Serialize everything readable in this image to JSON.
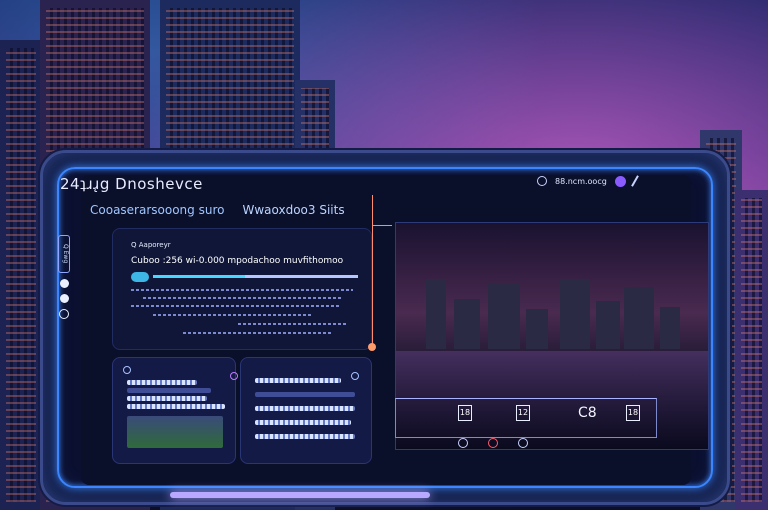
{
  "window": {
    "title": "24ʇɹɹ̨g Dnoshevce",
    "subtitle_left": "Cooaserarsooong suro",
    "subtitle_right": "Wwaoxdoo3 Siits"
  },
  "status_bar": {
    "icons": [
      "refresh-icon",
      "signal-icon",
      "avatar-dot",
      "edit-icon"
    ],
    "text": "88.ncm.oocg"
  },
  "info_panel": {
    "heading": "Q Aaporeyr",
    "line": "Cuboo :256 wi-0.000 mpodachoo muvfithomoo",
    "meter_level": 0.45
  },
  "left_controls": {
    "bar_label": "Q Ewg"
  },
  "bottom_strip": {
    "items": [
      "18",
      "12",
      "18"
    ],
    "value": "C8"
  },
  "colors": {
    "accent": "#3b86ff",
    "accent_glow": "#46d8ff",
    "orange": "#ff8c6a",
    "purple": "#8a5cff"
  }
}
